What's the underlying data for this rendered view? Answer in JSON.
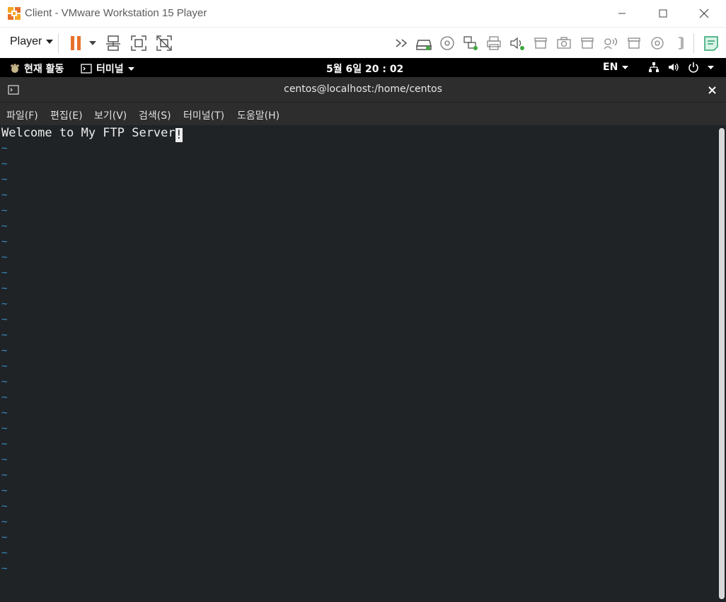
{
  "window": {
    "title": "Client - VMware Workstation 15 Player"
  },
  "toolbar": {
    "player_label": "Player",
    "icons": [
      "pause-icon",
      "send-ctrl-alt-del-icon",
      "fullscreen-icon",
      "unity-icon",
      "forward-icon",
      "hard-disk-icon",
      "cd-icon",
      "network-icon",
      "printer-icon",
      "sound-icon",
      "usb-icon",
      "camera-icon",
      "usb-icon",
      "bluetooth-icon",
      "usb-icon",
      "cd-icon",
      "bracket-icon",
      "message-icon"
    ],
    "accent": "#e8702a"
  },
  "gnome": {
    "activities": "현재 활동",
    "app_menu": "터미널",
    "clock": "5월 6일  20 : 02",
    "lang": "EN"
  },
  "terminal": {
    "title": "centos@localhost:/home/centos",
    "menu": [
      "파일(F)",
      "편집(E)",
      "보기(V)",
      "검색(S)",
      "터미널(T)",
      "도움말(H)"
    ],
    "first_line": "Welcome to My FTP Server",
    "cursor_char": "!",
    "tilde": "~",
    "tilde_count": 28
  }
}
